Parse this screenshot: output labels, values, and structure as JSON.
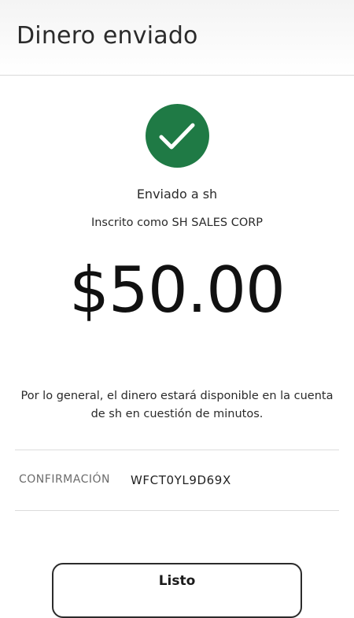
{
  "header": {
    "title": "Dinero enviado"
  },
  "status": {
    "icon": "check-circle-icon",
    "color": "#1f7a45"
  },
  "recipient": {
    "sent_to": "Enviado a sh",
    "enrolled_as": "Inscrito como SH SALES CORP"
  },
  "payment": {
    "amount": "$50.00",
    "availability_note": "Por lo general, el dinero estará disponible en la cuenta de sh en cuestión de minutos."
  },
  "confirmation": {
    "label": "CONFIRMACIÓN",
    "code": "WFCT0YL9D69X"
  },
  "actions": {
    "done_label": "Listo"
  }
}
